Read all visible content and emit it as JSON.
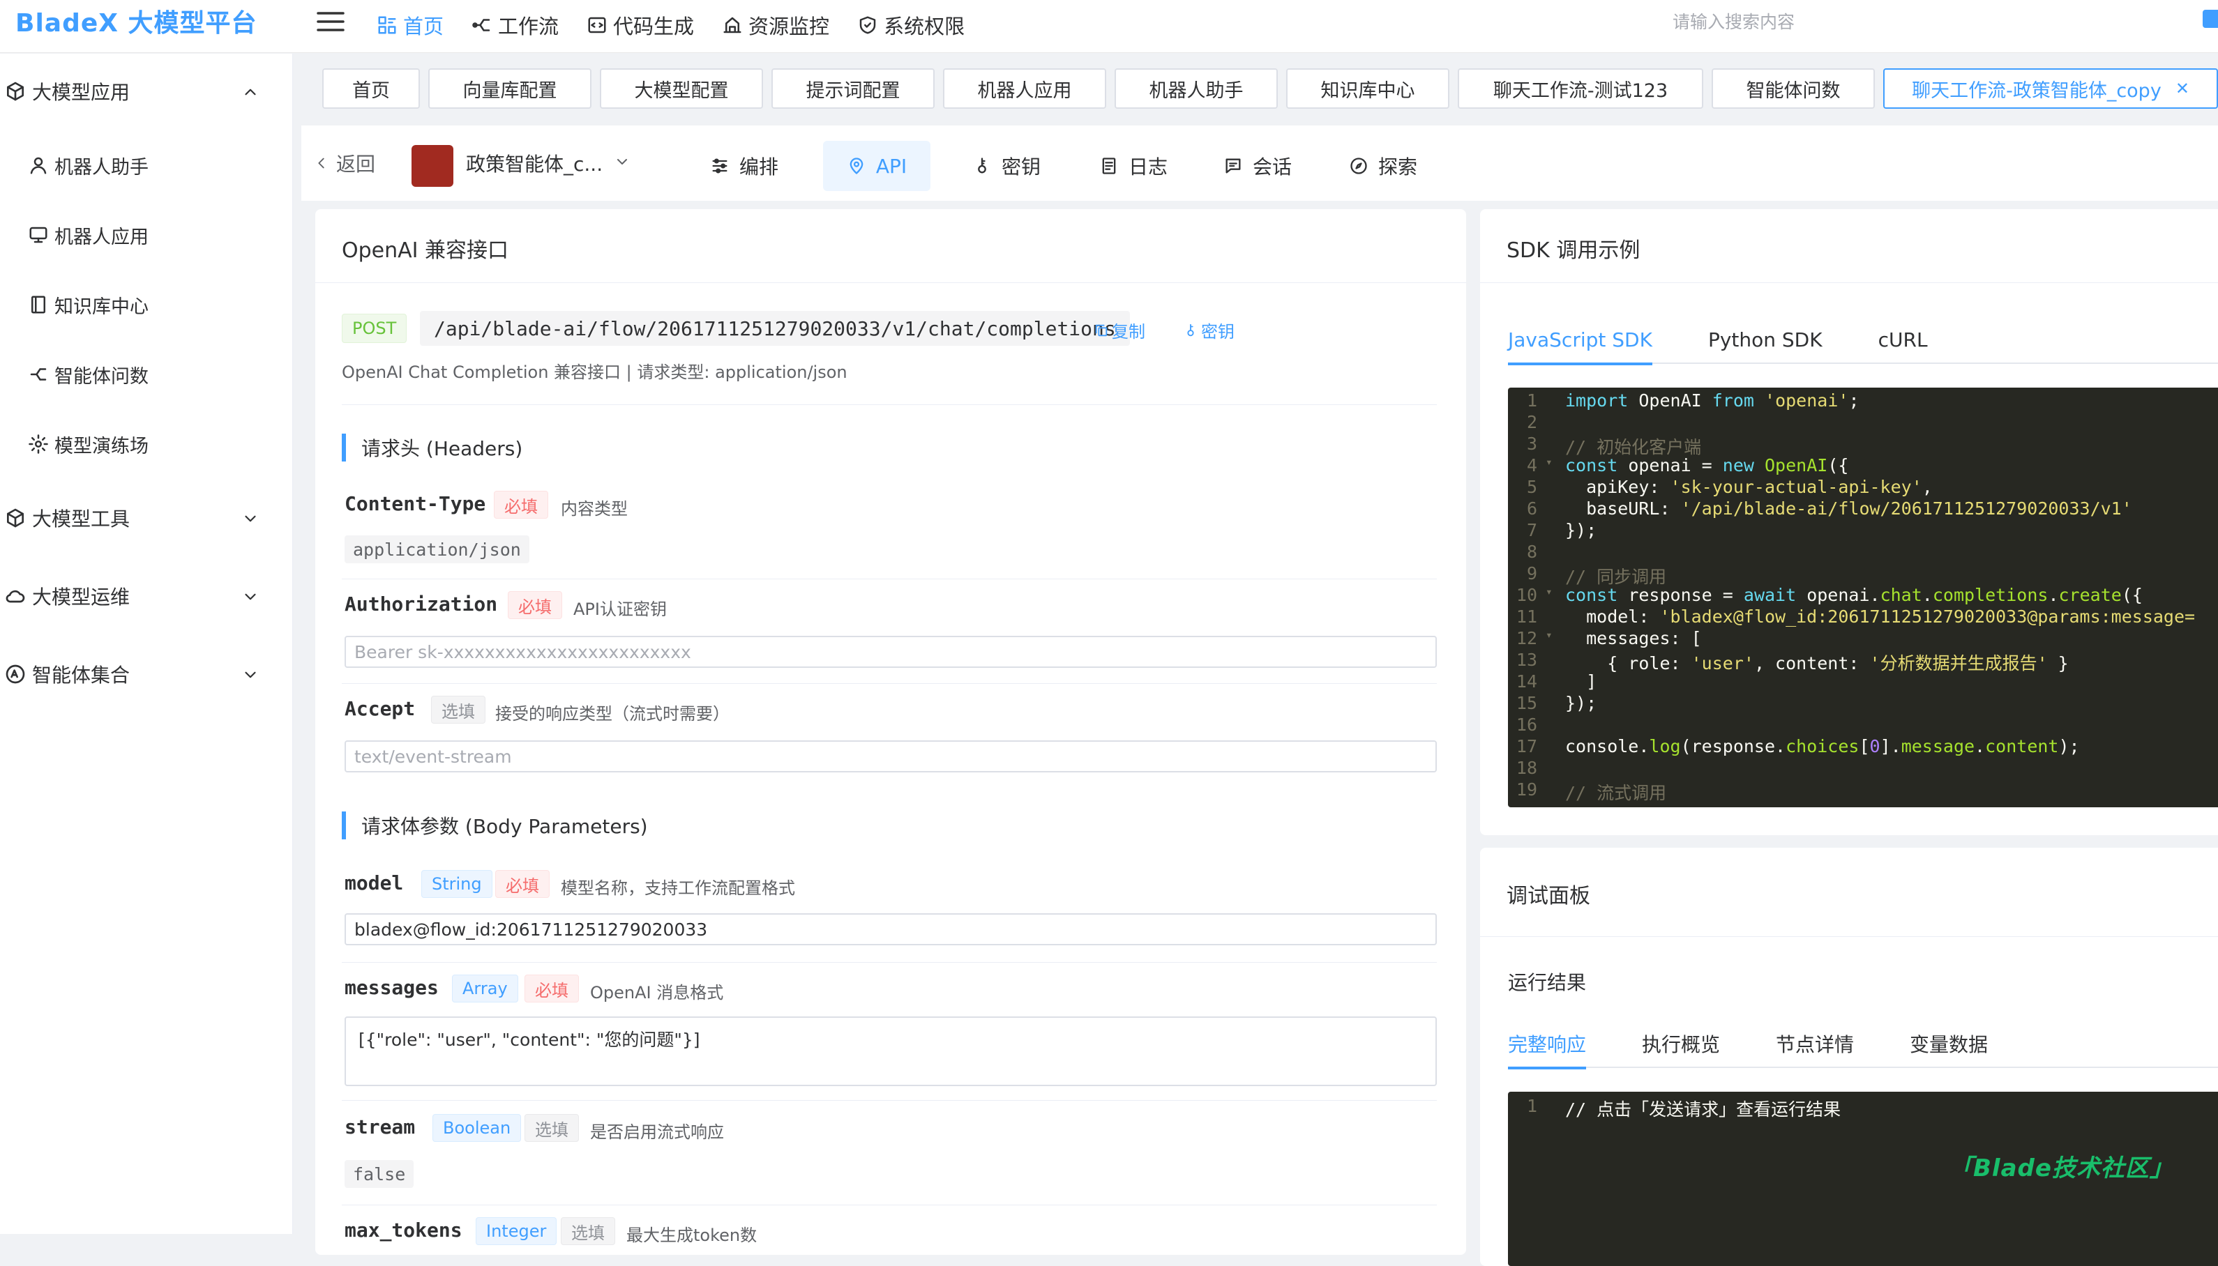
{
  "app": {
    "brand": "BladeX 大模型平台",
    "search_placeholder": "请输入搜索内容"
  },
  "topnav": [
    {
      "label": "首页",
      "icon": "home-icon",
      "active": true
    },
    {
      "label": "工作流",
      "icon": "workflow-icon"
    },
    {
      "label": "代码生成",
      "icon": "code-icon"
    },
    {
      "label": "资源监控",
      "icon": "monitor-icon"
    },
    {
      "label": "系统权限",
      "icon": "shield-icon"
    }
  ],
  "sidebar": {
    "groups": [
      {
        "label": "大模型应用",
        "icon": "cube-icon",
        "expanded": true,
        "items": [
          {
            "label": "机器人助手",
            "icon": "user-icon"
          },
          {
            "label": "机器人应用",
            "icon": "monitor-icon"
          },
          {
            "label": "知识库中心",
            "icon": "book-icon"
          },
          {
            "label": "智能体问数",
            "icon": "agent-icon"
          },
          {
            "label": "模型演练场",
            "icon": "gear-icon"
          }
        ]
      },
      {
        "label": "大模型工具",
        "icon": "cube-icon",
        "expanded": false
      },
      {
        "label": "大模型运维",
        "icon": "cloud-icon",
        "expanded": false
      },
      {
        "label": "智能体集合",
        "icon": "agent-icon",
        "expanded": false
      }
    ]
  },
  "tags": [
    "首页",
    "向量库配置",
    "大模型配置",
    "提示词配置",
    "机器人应用",
    "机器人助手",
    "知识库中心",
    "聊天工作流-测试123",
    "智能体问数",
    "聊天工作流-政策智能体_copy"
  ],
  "subbar": {
    "back": "返回",
    "agent_name": "政策智能体_c...",
    "tabs": [
      {
        "label": "编排",
        "icon": "sliders-icon"
      },
      {
        "label": "API",
        "icon": "location-icon",
        "active": true
      },
      {
        "label": "密钥",
        "icon": "key-icon"
      },
      {
        "label": "日志",
        "icon": "document-icon"
      },
      {
        "label": "会话",
        "icon": "chat-icon"
      },
      {
        "label": "探索",
        "icon": "compass-icon"
      }
    ]
  },
  "api": {
    "title": "OpenAI 兼容接口",
    "method": "POST",
    "path": "/api/blade-ai/flow/2061711251279020033/v1/chat/completions",
    "copy": "复制",
    "key": "密钥",
    "description": "OpenAI Chat Completion 兼容接口 | 请求类型: application/json",
    "headers_title": "请求头 (Headers)",
    "headers": [
      {
        "name": "Content-Type",
        "req": "必填",
        "desc": "内容类型",
        "value": "application/json"
      },
      {
        "name": "Authorization",
        "req": "必填",
        "desc": "API认证密钥",
        "placeholder": "Bearer sk-xxxxxxxxxxxxxxxxxxxxxxxx"
      },
      {
        "name": "Accept",
        "req": "选填",
        "desc": "接受的响应类型（流式时需要）",
        "placeholder": "text/event-stream"
      }
    ],
    "body_title": "请求体参数 (Body Parameters)",
    "body": [
      {
        "name": "model",
        "type": "String",
        "req": "必填",
        "desc": "模型名称，支持工作流配置格式",
        "value": "bladex@flow_id:2061711251279020033"
      },
      {
        "name": "messages",
        "type": "Array",
        "req": "必填",
        "desc": "OpenAI 消息格式",
        "value": "[{\"role\": \"user\", \"content\": \"您的问题\"}]"
      },
      {
        "name": "stream",
        "type": "Boolean",
        "req": "选填",
        "desc": "是否启用流式响应",
        "value": "false"
      },
      {
        "name": "max_tokens",
        "type": "Integer",
        "req": "选填",
        "desc": "最大生成token数"
      }
    ]
  },
  "sdk": {
    "title": "SDK 调用示例",
    "tabs": [
      "JavaScript SDK",
      "Python SDK",
      "cURL"
    ],
    "active_tab": 0
  },
  "debug": {
    "title": "调试面板",
    "run_label": "运行结果",
    "tabs": [
      "完整响应",
      "执行概览",
      "节点详情",
      "变量数据"
    ],
    "active_tab": 0,
    "output": "// 点击「发送请求」查看运行结果"
  },
  "watermark": "「Blade技术社区」",
  "colors": {
    "primary": "#409eff",
    "danger": "#f56c6c",
    "success": "#67c23a",
    "code_bg": "#272822"
  }
}
